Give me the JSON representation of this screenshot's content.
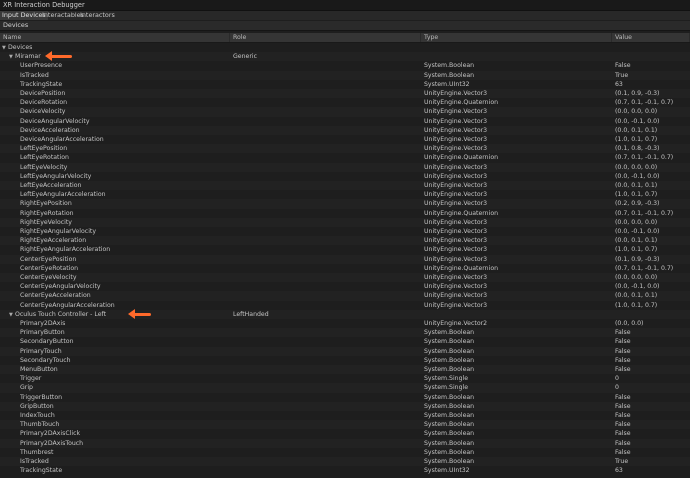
{
  "window": {
    "title": "XR Interaction Debugger"
  },
  "tabs": [
    "Input Devices",
    "Interactables",
    "Interactors"
  ],
  "section_title": "Devices",
  "columns": [
    "Name",
    "Role",
    "Type",
    "Value"
  ],
  "colors": {
    "accent": "#ff6a2b"
  },
  "rows": [
    {
      "depth": 0,
      "expander": "collapse",
      "name": "Devices",
      "role": "",
      "type": "",
      "value": ""
    },
    {
      "depth": 1,
      "expander": "collapse",
      "name": "Miramar",
      "role": "Generic",
      "type": "",
      "value": "",
      "marked": true
    },
    {
      "depth": 2,
      "name": "UserPresence",
      "role": "",
      "type": "System.Boolean",
      "value": "False"
    },
    {
      "depth": 2,
      "name": "IsTracked",
      "role": "",
      "type": "System.Boolean",
      "value": "True"
    },
    {
      "depth": 2,
      "name": "TrackingState",
      "role": "",
      "type": "System.UInt32",
      "value": "63"
    },
    {
      "depth": 2,
      "name": "DevicePosition",
      "role": "",
      "type": "UnityEngine.Vector3",
      "value": "(0.1, 0.9, -0.3)"
    },
    {
      "depth": 2,
      "name": "DeviceRotation",
      "role": "",
      "type": "UnityEngine.Quaternion",
      "value": "(0.7, 0.1, -0.1, 0.7)"
    },
    {
      "depth": 2,
      "name": "DeviceVelocity",
      "role": "",
      "type": "UnityEngine.Vector3",
      "value": "(0.0, 0.0, 0.0)"
    },
    {
      "depth": 2,
      "name": "DeviceAngularVelocity",
      "role": "",
      "type": "UnityEngine.Vector3",
      "value": "(0.0, -0.1, 0.0)"
    },
    {
      "depth": 2,
      "name": "DeviceAcceleration",
      "role": "",
      "type": "UnityEngine.Vector3",
      "value": "(0.0, 0.1, 0.1)"
    },
    {
      "depth": 2,
      "name": "DeviceAngularAcceleration",
      "role": "",
      "type": "UnityEngine.Vector3",
      "value": "(1.0, 0.1, 0.7)"
    },
    {
      "depth": 2,
      "name": "LeftEyePosition",
      "role": "",
      "type": "UnityEngine.Vector3",
      "value": "(0.1, 0.8, -0.3)"
    },
    {
      "depth": 2,
      "name": "LeftEyeRotation",
      "role": "",
      "type": "UnityEngine.Quaternion",
      "value": "(0.7, 0.1, -0.1, 0.7)"
    },
    {
      "depth": 2,
      "name": "LeftEyeVelocity",
      "role": "",
      "type": "UnityEngine.Vector3",
      "value": "(0.0, 0.0, 0.0)"
    },
    {
      "depth": 2,
      "name": "LeftEyeAngularVelocity",
      "role": "",
      "type": "UnityEngine.Vector3",
      "value": "(0.0, -0.1, 0.0)"
    },
    {
      "depth": 2,
      "name": "LeftEyeAcceleration",
      "role": "",
      "type": "UnityEngine.Vector3",
      "value": "(0.0, 0.1, 0.1)"
    },
    {
      "depth": 2,
      "name": "LeftEyeAngularAcceleration",
      "role": "",
      "type": "UnityEngine.Vector3",
      "value": "(1.0, 0.1, 0.7)"
    },
    {
      "depth": 2,
      "name": "RightEyePosition",
      "role": "",
      "type": "UnityEngine.Vector3",
      "value": "(0.2, 0.9, -0.3)"
    },
    {
      "depth": 2,
      "name": "RightEyeRotation",
      "role": "",
      "type": "UnityEngine.Quaternion",
      "value": "(0.7, 0.1, -0.1, 0.7)"
    },
    {
      "depth": 2,
      "name": "RightEyeVelocity",
      "role": "",
      "type": "UnityEngine.Vector3",
      "value": "(0.0, 0.0, 0.0)"
    },
    {
      "depth": 2,
      "name": "RightEyeAngularVelocity",
      "role": "",
      "type": "UnityEngine.Vector3",
      "value": "(0.0, -0.1, 0.0)"
    },
    {
      "depth": 2,
      "name": "RightEyeAcceleration",
      "role": "",
      "type": "UnityEngine.Vector3",
      "value": "(0.0, 0.1, 0.1)"
    },
    {
      "depth": 2,
      "name": "RightEyeAngularAcceleration",
      "role": "",
      "type": "UnityEngine.Vector3",
      "value": "(1.0, 0.1, 0.7)"
    },
    {
      "depth": 2,
      "name": "CenterEyePosition",
      "role": "",
      "type": "UnityEngine.Vector3",
      "value": "(0.1, 0.9, -0.3)"
    },
    {
      "depth": 2,
      "name": "CenterEyeRotation",
      "role": "",
      "type": "UnityEngine.Quaternion",
      "value": "(0.7, 0.1, -0.1, 0.7)"
    },
    {
      "depth": 2,
      "name": "CenterEyeVelocity",
      "role": "",
      "type": "UnityEngine.Vector3",
      "value": "(0.0, 0.0, 0.0)"
    },
    {
      "depth": 2,
      "name": "CenterEyeAngularVelocity",
      "role": "",
      "type": "UnityEngine.Vector3",
      "value": "(0.0, -0.1, 0.0)"
    },
    {
      "depth": 2,
      "name": "CenterEyeAcceleration",
      "role": "",
      "type": "UnityEngine.Vector3",
      "value": "(0.0, 0.1, 0.1)"
    },
    {
      "depth": 2,
      "name": "CenterEyeAngularAcceleration",
      "role": "",
      "type": "UnityEngine.Vector3",
      "value": "(1.0, 0.1, 0.7)"
    },
    {
      "depth": 1,
      "expander": "collapse",
      "name": "Oculus Touch Controller - Left",
      "role": "LeftHanded",
      "type": "",
      "value": "",
      "marked": true
    },
    {
      "depth": 2,
      "name": "Primary2DAxis",
      "role": "",
      "type": "UnityEngine.Vector2",
      "value": "(0.0, 0.0)"
    },
    {
      "depth": 2,
      "name": "PrimaryButton",
      "role": "",
      "type": "System.Boolean",
      "value": "False"
    },
    {
      "depth": 2,
      "name": "SecondaryButton",
      "role": "",
      "type": "System.Boolean",
      "value": "False"
    },
    {
      "depth": 2,
      "name": "PrimaryTouch",
      "role": "",
      "type": "System.Boolean",
      "value": "False"
    },
    {
      "depth": 2,
      "name": "SecondaryTouch",
      "role": "",
      "type": "System.Boolean",
      "value": "False"
    },
    {
      "depth": 2,
      "name": "MenuButton",
      "role": "",
      "type": "System.Boolean",
      "value": "False"
    },
    {
      "depth": 2,
      "name": "Trigger",
      "role": "",
      "type": "System.Single",
      "value": "0"
    },
    {
      "depth": 2,
      "name": "Grip",
      "role": "",
      "type": "System.Single",
      "value": "0"
    },
    {
      "depth": 2,
      "name": "TriggerButton",
      "role": "",
      "type": "System.Boolean",
      "value": "False"
    },
    {
      "depth": 2,
      "name": "GripButton",
      "role": "",
      "type": "System.Boolean",
      "value": "False"
    },
    {
      "depth": 2,
      "name": "IndexTouch",
      "role": "",
      "type": "System.Boolean",
      "value": "False"
    },
    {
      "depth": 2,
      "name": "ThumbTouch",
      "role": "",
      "type": "System.Boolean",
      "value": "False"
    },
    {
      "depth": 2,
      "name": "Primary2DAxisClick",
      "role": "",
      "type": "System.Boolean",
      "value": "False"
    },
    {
      "depth": 2,
      "name": "Primary2DAxisTouch",
      "role": "",
      "type": "System.Boolean",
      "value": "False"
    },
    {
      "depth": 2,
      "name": "Thumbrest",
      "role": "",
      "type": "System.Boolean",
      "value": "False"
    },
    {
      "depth": 2,
      "name": "IsTracked",
      "role": "",
      "type": "System.Boolean",
      "value": "True"
    },
    {
      "depth": 2,
      "name": "TrackingState",
      "role": "",
      "type": "System.UInt32",
      "value": "63"
    }
  ]
}
